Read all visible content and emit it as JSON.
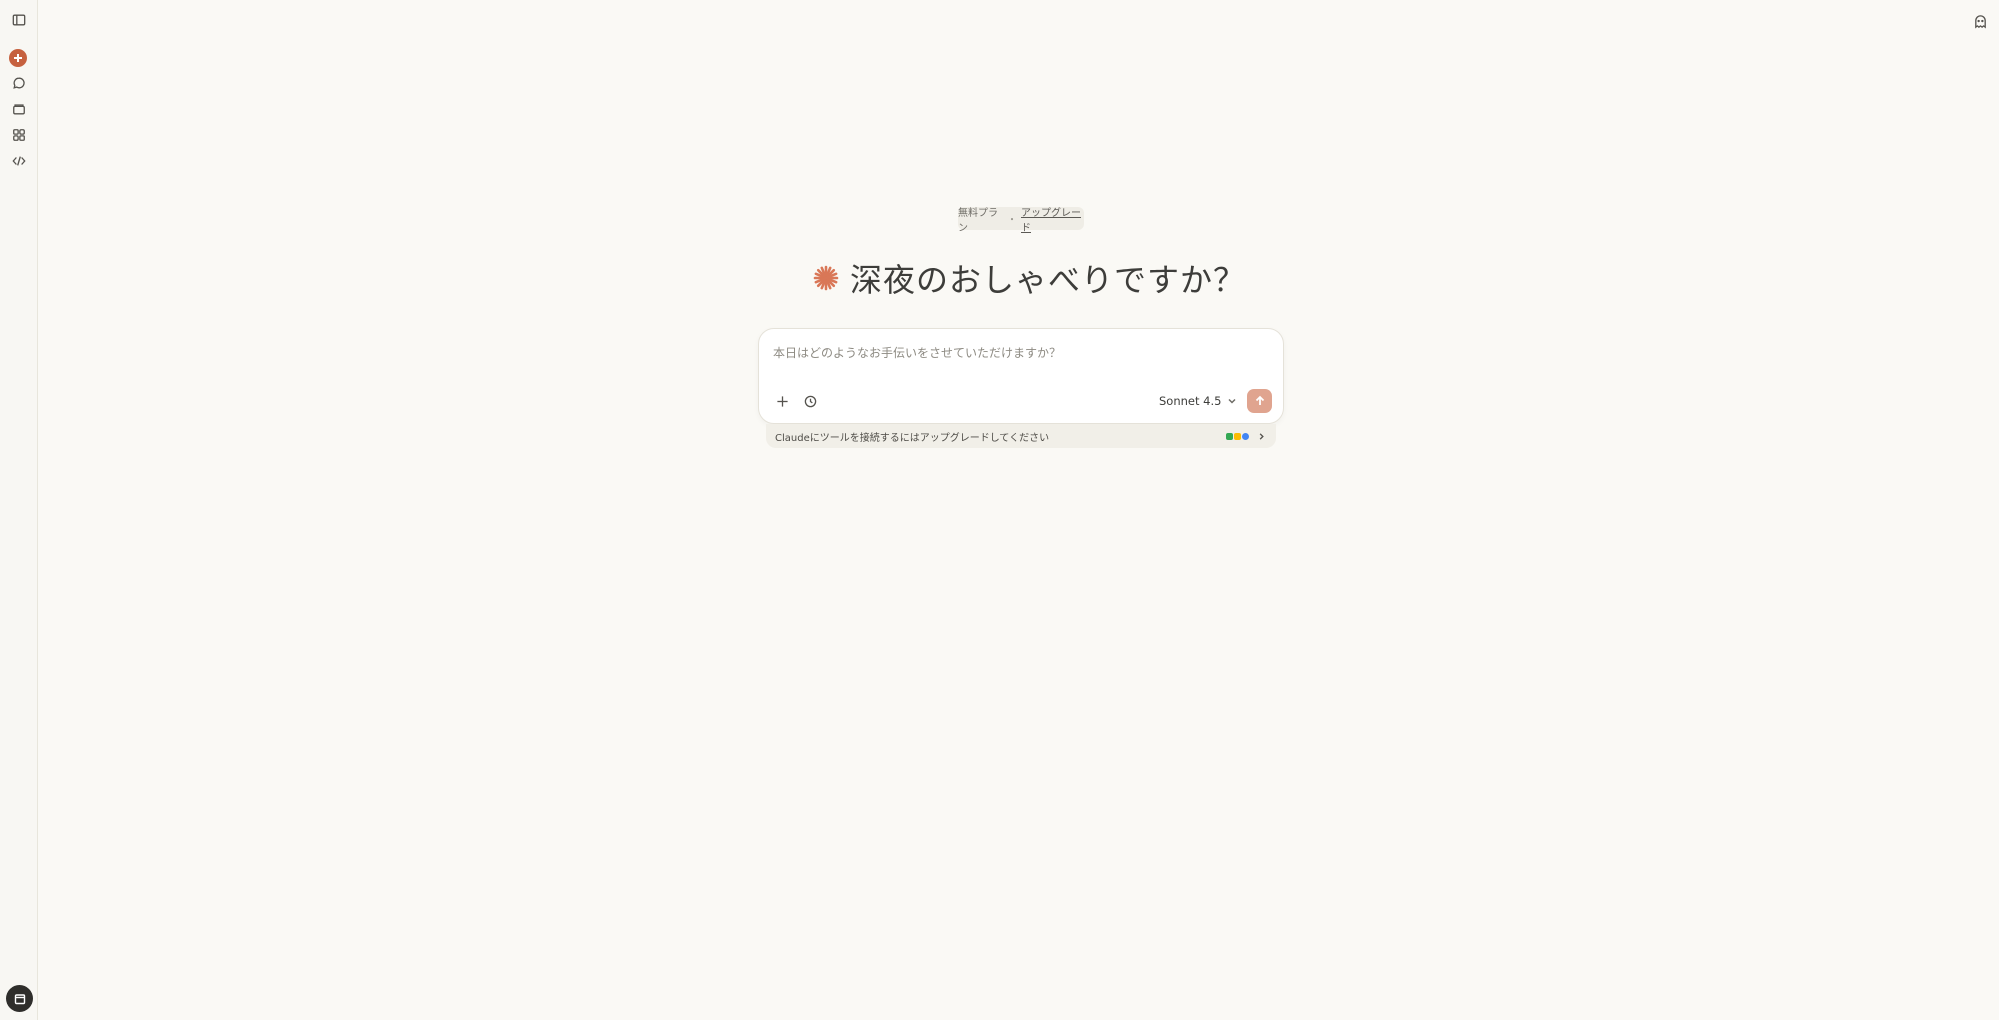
{
  "plan": {
    "label": "無料プラン",
    "separator": "・",
    "upgrade": "アップグレード"
  },
  "greeting": "深夜のおしゃべりですか？",
  "composer": {
    "placeholder": "本日はどのようなお手伝いをさせていただけますか？",
    "model": "Sonnet 4.5"
  },
  "tools_banner": {
    "text": "Claudeにツールを接続するにはアップグレードしてください",
    "icons": [
      "gmail-icon",
      "calendar-icon",
      "drive-icon"
    ]
  },
  "colors": {
    "accent": "#c6613f",
    "send_disabled": "#e0a48f",
    "background": "#faf9f5"
  },
  "sidebar": {
    "icons": [
      "sidebar-toggle-icon",
      "new-chat-icon",
      "chats-icon",
      "projects-icon",
      "artifacts-icon",
      "code-icon"
    ],
    "avatar_icon": "user-avatar-icon"
  }
}
